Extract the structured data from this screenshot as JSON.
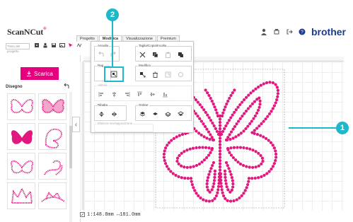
{
  "app": {
    "logo_text": "ScanNCut",
    "logo_mark": "®",
    "brand": "brother"
  },
  "tabs": [
    {
      "label": "Progetto",
      "active": false
    },
    {
      "label": "Modifica",
      "active": true
    },
    {
      "label": "Visualizzazione",
      "active": false
    },
    {
      "label": "Premium",
      "active": false
    }
  ],
  "toolbar": {
    "project_placeholder": "Titolo del progetto"
  },
  "left_panel": {
    "download_label": "Scarica",
    "section_title": "Disegno"
  },
  "edit_panel": {
    "groups": {
      "undo": "Annulla",
      "cut_copy_paste": "Taglia/Copia/Incolla",
      "group": "Rag",
      "modify": "Modifica",
      "align": "Allinea",
      "flip": "Ribalta",
      "order": "Ordine",
      "overlap": "Elabora sovrapposizione"
    }
  },
  "status": {
    "size_readout": "1:148.8mm ↔181.0mm"
  },
  "callouts": {
    "one": "1",
    "two": "2"
  },
  "colors": {
    "accent": "#e6007e",
    "callout": "#1eb8c8",
    "brand": "#1a3c8f",
    "rhinestone": "#e0187f"
  }
}
